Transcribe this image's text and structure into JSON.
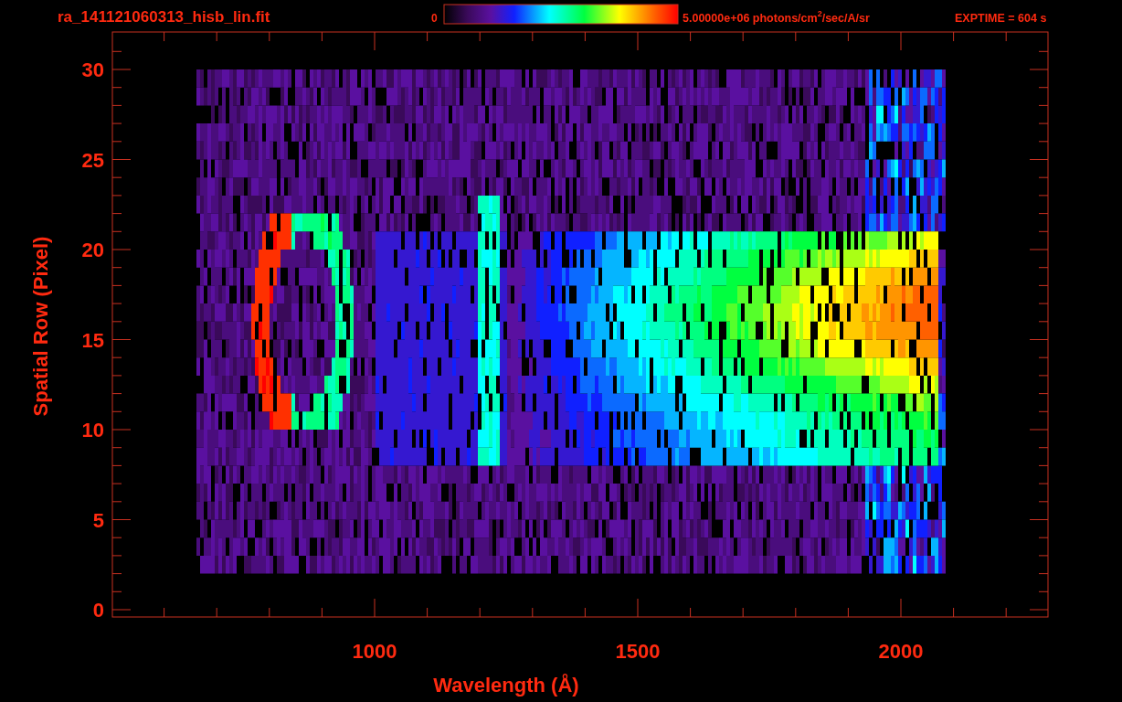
{
  "plot": {
    "title": "ra_141121060313_hisb_lin.fit",
    "colorbar": {
      "min_label": "0",
      "max_label": "5.00000e+06 photons/cm$^{2}$/sec/A/sr"
    },
    "exposure": "EXPTIME = 604 s",
    "ylabel": "Spatial Row (Pixel)",
    "yticks": [
      "30",
      "25",
      "20",
      "15",
      "10",
      "5",
      "0"
    ],
    "xlabel": "Wavelength (Å)",
    "xticks": [
      "1000",
      "1500",
      "2000"
    ]
  }
}
